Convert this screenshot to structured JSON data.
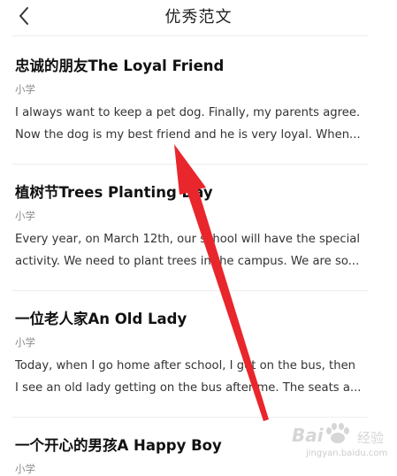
{
  "header": {
    "title": "优秀范文",
    "back_icon": "chevron-left-icon"
  },
  "articles": [
    {
      "title": "忠诚的朋友The Loyal Friend",
      "tag": "小学",
      "excerpt_lines": [
        "I always want to keep a pet dog. Finally, my parents agree.",
        "Now the dog is my best friend and he is very loyal. When..."
      ]
    },
    {
      "title": "植树节Trees Planting Day",
      "tag": "小学",
      "excerpt_lines": [
        "Every year, on March 12th, our school will have the special",
        "activity. We need to plant trees in the campus. We are so..."
      ]
    },
    {
      "title": "一位老人家An Old Lady",
      "tag": "小学",
      "excerpt_lines": [
        "Today, when I go home after school, I get on the bus, then",
        "I see an old lady getting on the bus after me. The seats a..."
      ]
    },
    {
      "title": "一个开心的男孩A Happy Boy",
      "tag": "小学",
      "excerpt_lines": []
    }
  ],
  "watermark": {
    "brand": "Bai",
    "brand_suffix": "经验",
    "url": "jingyan.baidu.com"
  },
  "colors": {
    "annotation_arrow": "#e8262c",
    "divider": "#ededed",
    "tag_text": "#8a8a8a"
  }
}
